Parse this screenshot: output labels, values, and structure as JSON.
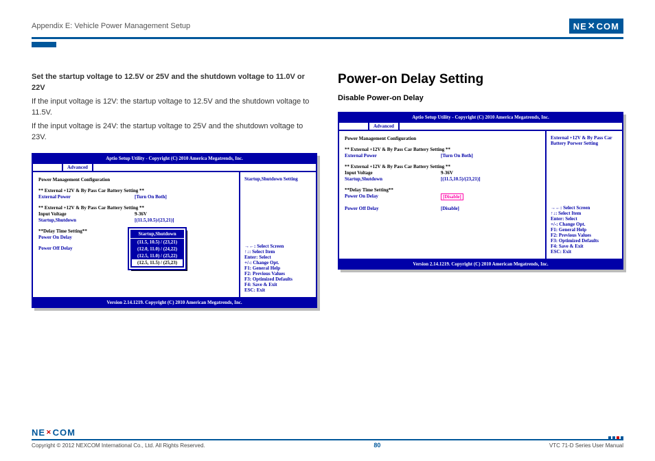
{
  "header": {
    "appendix": "Appendix E: Vehicle Power Management Setup",
    "brand_left": "NE",
    "brand_right": "COM"
  },
  "left": {
    "title": "Set the startup voltage to 12.5V or 25V and the shutdown voltage to 11.0V or 22V",
    "p1": "If the input voltage is 12V: the startup voltage to 12.5V and the shutdown voltage to 11.5V.",
    "p2": "If the input voltage is 24V: the startup voltage to 25V and the shutdown voltage to 23V.",
    "bios": {
      "title": "Aptio Setup Utility - Copyright (C) 2010 America Megatrends, Inc.",
      "tab": "Advanced",
      "section": "Power Management Configuration",
      "grp1": "** External +12V & By Pass Car Battery Setting **",
      "external_power_lbl": "External Power",
      "external_power_val": "[Turn On Both]",
      "grp2": "** External +12V & By Pass Car Battery Setting **",
      "input_voltage_lbl": "Input Voltage",
      "input_voltage_val": "9-36V",
      "startup_shutdown_lbl": "Startup,Shutdown",
      "startup_shutdown_val": "[(11.5,10.5)/(23,21)]",
      "delay_header": "**Delay Time Setting**",
      "power_on_delay": "Power On Delay",
      "power_off_delay": "Power Off Delay",
      "right_help": "Startup,Shutdown Setting",
      "hints": [
        "→←: Select Screen",
        "↑↓: Select Item",
        "Enter: Select",
        "+/-: Change Opt.",
        "F1: General Help",
        "F2: Previous Values",
        "F3: Optimized Defaults",
        "F4: Save & Exit",
        "ESC: Exit"
      ],
      "footer": "Version 2.14.1219. Copyright (C) 2010 American Megatrends, Inc.",
      "popup": {
        "title": "Startup,Shutdown",
        "options": [
          "(11.5, 10.5) / (23,21)",
          "(12.0, 11.0) / (24,22)",
          "(12.5, 11.0) / (25,22)",
          "(12.5, 11.5) / (25,23)"
        ],
        "selected_index": 3
      }
    }
  },
  "right": {
    "h2": "Power-on Delay Setting",
    "h3": "Disable Power-on Delay",
    "bios": {
      "title": "Aptio Setup Utility - Copyright (C) 2010 America Megatrends, Inc.",
      "tab": "Advanced",
      "section": "Power Management Configuration",
      "grp1": "** External +12V & By Pass Car Battery Setting **",
      "external_power_lbl": "External Power",
      "external_power_val": "[Turn On Both]",
      "grp2": "** External +12V & By Pass Car Battery Setting **",
      "input_voltage_lbl": "Input Voltage",
      "input_voltage_val": "9-36V",
      "startup_shutdown_lbl": "Startup,Shutdown",
      "startup_shutdown_val": "[(11.5,10.5)/(23,21)]",
      "delay_header": "**Delay Time Setting**",
      "power_on_delay_lbl": "Power On Delay",
      "power_on_delay_val": "[Disable]",
      "power_off_delay_lbl": "Power Off Delay",
      "power_off_delay_val": "[Disable]",
      "right_help1": "External +12V & By Pass Car",
      "right_help2": "Battery Porwer Setting",
      "hints": [
        "→←: Select Screen",
        "↑↓: Select Item",
        "Enter: Select",
        "+/-: Change Opt.",
        "F1: General Help",
        "F2: Previous Values",
        "F3: Optimized Defaults",
        "F4: Save & Exit",
        "ESC: Exit"
      ],
      "footer": "Version 2.14.1219. Copyright (C) 2010 American Megatrends, Inc."
    }
  },
  "footer": {
    "copyright": "Copyright © 2012 NEXCOM International Co., Ltd. All Rights Reserved.",
    "page": "80",
    "manual": "VTC 71-D Series User Manual"
  }
}
